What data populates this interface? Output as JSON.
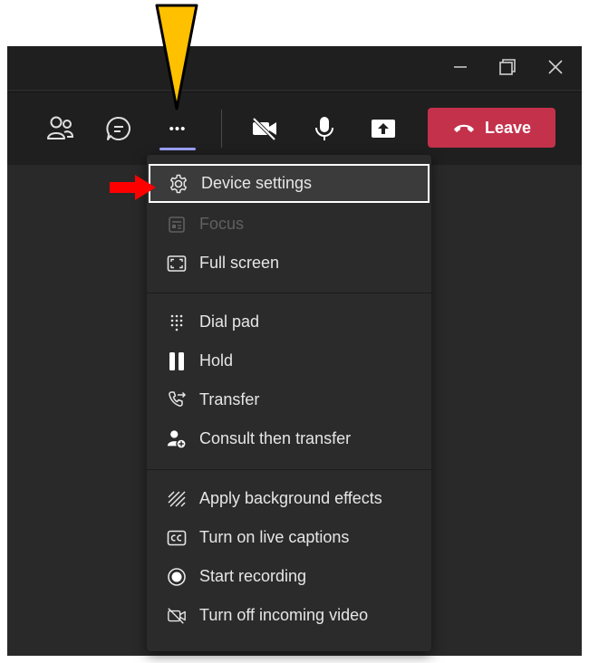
{
  "window": {
    "title_buttons": [
      {
        "name": "minimize",
        "icon": "minimize-icon"
      },
      {
        "name": "restore",
        "icon": "restore-icon"
      },
      {
        "name": "close",
        "icon": "close-icon"
      }
    ]
  },
  "toolbar": {
    "participants_icon": "people-icon",
    "chat_icon": "chat-icon",
    "more_label": "•••",
    "camera_icon": "video-off-icon",
    "mic_icon": "microphone-icon",
    "share_icon": "share-tray-icon",
    "leave_label": "Leave",
    "leave_color": "#c4314b"
  },
  "menu": {
    "items": [
      {
        "label": "Device settings",
        "icon": "gear-icon",
        "state": "highlighted"
      },
      {
        "label": "Focus",
        "icon": "focus-icon",
        "state": "disabled"
      },
      {
        "label": "Full screen",
        "icon": "fullscreen-icon",
        "state": "normal"
      },
      {
        "label": "Dial pad",
        "icon": "dialpad-icon",
        "state": "normal"
      },
      {
        "label": "Hold",
        "icon": "pause-icon",
        "state": "normal"
      },
      {
        "label": "Transfer",
        "icon": "transfer-icon",
        "state": "normal"
      },
      {
        "label": "Consult then transfer",
        "icon": "consult-transfer-icon",
        "state": "normal"
      },
      {
        "label": "Apply background effects",
        "icon": "background-effects-icon",
        "state": "normal"
      },
      {
        "label": "Turn on live captions",
        "icon": "captions-icon",
        "state": "normal"
      },
      {
        "label": "Start recording",
        "icon": "record-icon",
        "state": "normal"
      },
      {
        "label": "Turn off incoming video",
        "icon": "video-off-icon",
        "state": "normal"
      }
    ]
  },
  "annotations": {
    "yellow_arrow_color": "#ffc000",
    "red_arrow_color": "#ff0000"
  }
}
